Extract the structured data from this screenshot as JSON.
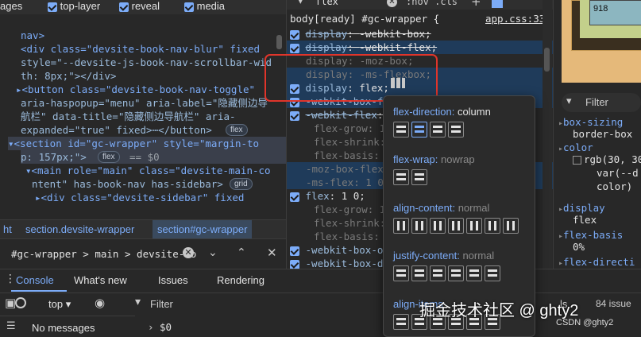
{
  "left_top": {
    "partial": "ages",
    "checks": [
      "top-layer",
      "reveal",
      "media"
    ]
  },
  "dom_lines": [
    {
      "text": "nav>",
      "cls": "tag"
    },
    {
      "text": "<div class=\"devsite-book-nav-blur\" fixed",
      "cls": "tag"
    },
    {
      "text": "style=\"--devsite-js-book-nav-scrollbar-wid",
      "cls": "attr"
    },
    {
      "text": "th: 8px;\"></div>",
      "cls": "attr"
    },
    {
      "text": "▸<button class=\"devsite-book-nav-toggle\"",
      "cls": "tag"
    },
    {
      "text": "aria-haspopup=\"menu\" aria-label=\"隐藏侧边导",
      "cls": "attr"
    },
    {
      "text": "航栏\" data-title=\"隐藏侧边导航栏\" aria-",
      "cls": "attr"
    },
    {
      "text": "expanded=\"true\" fixed>⋯</button>",
      "cls": "attr"
    },
    {
      "text": "▾<section id=\"gc-wrapper\" style=\"margin-to",
      "cls": "tag"
    },
    {
      "text": "p: 157px;\">",
      "cls": "attr"
    },
    {
      "text": "▾<main role=\"main\" class=\"devsite-main-co",
      "cls": "tag"
    },
    {
      "text": "ntent\" has-book-nav has-sidebar>",
      "cls": "attr"
    },
    {
      "text": "▸<div class=\"devsite-sidebar\" fixed",
      "cls": "tag"
    }
  ],
  "badges": {
    "flex1": "flex",
    "flex2": "flex",
    "grid": "grid",
    "dollar": "== $0"
  },
  "breadcrumb": [
    "ht",
    "section.devsite-wrapper",
    "section#gc-wrapper"
  ],
  "dom_search": {
    "value": "#gc-wrapper > main > devsite-co"
  },
  "styles": {
    "filter_value": "flex",
    "cls_label": ":hov  .cls",
    "selector": "body[ready] #gc-wrapper {",
    "source": "app.css:33",
    "rows": [
      {
        "p": "display",
        "v": "-webkit-box;",
        "state": "strike"
      },
      {
        "p": "display",
        "v": "-webkit-flex;",
        "state": "strike"
      },
      {
        "p": "display",
        "v": "-moz-box;",
        "state": "dim"
      },
      {
        "p": "display",
        "v": "-ms-flexbox;",
        "state": "dim"
      },
      {
        "p": "display",
        "v": "flex;",
        "state": "on"
      },
      {
        "p": "-webkit-box-flex",
        "v": "1;",
        "state": "on"
      },
      {
        "p": "-webkit-flex",
        "v": "1 0;",
        "state": "strike"
      },
      {
        "p": "flex-grow",
        "v": "1;",
        "state": "dim"
      },
      {
        "p": "flex-shrink",
        "v": "0;",
        "state": "dim"
      },
      {
        "p": "flex-basis",
        "v": "0%;",
        "state": "dim"
      },
      {
        "p": "-moz-box-flex",
        "v": "1;",
        "state": "dim"
      },
      {
        "p": "-ms-flex",
        "v": "1 0;",
        "state": "dim"
      },
      {
        "p": "flex",
        "v": "1 0;",
        "state": "on"
      },
      {
        "p": "flex-grow",
        "v": "1;",
        "state": "dim"
      },
      {
        "p": "flex-shrink",
        "v": "0;",
        "state": "dim"
      },
      {
        "p": "flex-basis",
        "v": "0%;",
        "state": "dim"
      },
      {
        "p": "-webkit-box-or",
        "v": "",
        "state": "on"
      },
      {
        "p": "-webkit-box-di",
        "v": "",
        "state": "on"
      },
      {
        "p": "-webkit-flex-d",
        "v": "",
        "state": "on"
      }
    ]
  },
  "popup": {
    "sections": [
      {
        "label": "flex-direction",
        "value": "column"
      },
      {
        "label": "flex-wrap",
        "value": "nowrap"
      },
      {
        "label": "align-content",
        "value": "normal"
      },
      {
        "label": "justify-content",
        "value": "normal"
      },
      {
        "label": "align-items",
        "value": ""
      }
    ]
  },
  "computed": {
    "box_number": "918",
    "filter_placeholder": "Filter",
    "items": [
      {
        "name": "box-sizing",
        "value": "border-box"
      },
      {
        "name": "color",
        "value": "rgb(30, 30"
      },
      {
        "name": "",
        "value": "var(--d"
      },
      {
        "name": "",
        "value": "color)"
      },
      {
        "name": "display",
        "value": "flex"
      },
      {
        "name": "flex-basis",
        "value": "0%"
      },
      {
        "name": "flex-directi",
        "value": ""
      }
    ]
  },
  "console": {
    "tabs": [
      "Console",
      "What's new",
      "Issues",
      "Rendering"
    ],
    "context": "top",
    "filter_placeholder": "Filter",
    "levels": "ls",
    "issues": "84 issue",
    "messages": "No messages",
    "prompt": "$0"
  },
  "watermark": "掘金技术社区 @ ghty2",
  "csdn": "CSDN @ghty2",
  "colors": {
    "accent": "#7cacf8",
    "highlight": "#1f3b5a",
    "red": "#e0352b"
  }
}
